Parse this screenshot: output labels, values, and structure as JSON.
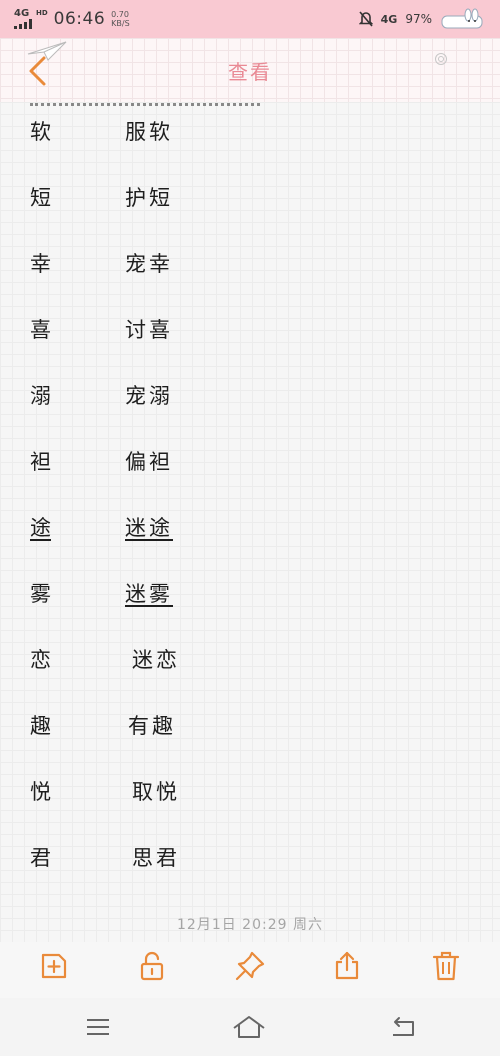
{
  "status_bar": {
    "network": "4G",
    "network_sub": "HD",
    "time": "06:46",
    "speed_value": "0.70",
    "speed_unit": "KB/S",
    "network_right": "4G",
    "battery": "97%"
  },
  "header": {
    "title": "查看"
  },
  "entries": [
    {
      "char": "软",
      "word": "服软"
    },
    {
      "char": "短",
      "word": "护短"
    },
    {
      "char": "幸",
      "word": "宠幸"
    },
    {
      "char": "喜",
      "word": "讨喜"
    },
    {
      "char": "溺",
      "word": "宠溺"
    },
    {
      "char": "袒",
      "word": "偏袒"
    },
    {
      "char": "途",
      "word": "迷途"
    },
    {
      "char": "雾",
      "word": "迷雾"
    },
    {
      "char": "恋",
      "word": "迷恋"
    },
    {
      "char": "趣",
      "word": "有趣"
    },
    {
      "char": "悦",
      "word": "取悦"
    },
    {
      "char": "君",
      "word": "思君"
    }
  ],
  "timestamp": "12月1日 20:29 周六",
  "colors": {
    "accent": "#e98a3a",
    "title_pink": "#e98a95",
    "status_pink": "#f9c9d2"
  },
  "icons": {
    "toolbar": [
      "add-note-icon",
      "unlock-icon",
      "pin-icon",
      "share-icon",
      "trash-icon"
    ],
    "nav": [
      "menu-icon",
      "home-icon",
      "back-icon"
    ]
  }
}
